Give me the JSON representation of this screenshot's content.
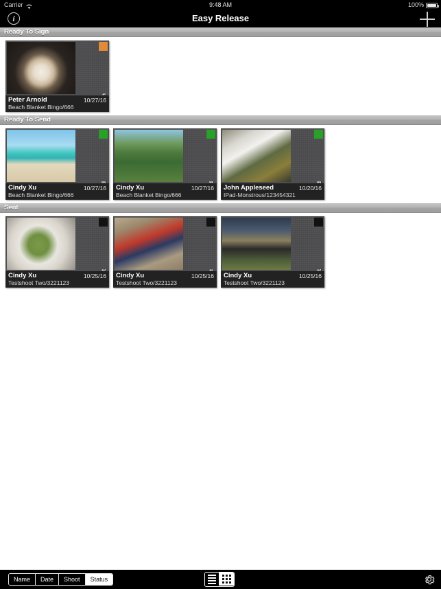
{
  "status_bar": {
    "carrier": "Carrier",
    "wifi_icon": "wifi-icon",
    "time": "9:48 AM",
    "battery_percent": "100%",
    "battery_icon": "battery-icon"
  },
  "nav_bar": {
    "title": "Easy Release",
    "info_icon": "info-icon",
    "info_label": "i",
    "add_icon": "plus-icon"
  },
  "sections": [
    {
      "title": "Ready To Sign",
      "status_color": "#e08a3c",
      "status_label": "Ready To Sign",
      "cards": [
        {
          "name": "Peter Arnold",
          "date": "10/27/16",
          "shoot": "Beach Blanket Bingo/666",
          "status_label": "Ready To Sign",
          "status_color": "#e08a3c",
          "thumb": "tuxedo-cat-portrait"
        }
      ]
    },
    {
      "title": "Ready To Send",
      "status_color": "#27a127",
      "status_label": "Ready To Send",
      "cards": [
        {
          "name": "Cindy Xu",
          "date": "10/27/16",
          "shoot": "Beach Blanket Bingo/666",
          "status_label": "Ready To Send",
          "status_color": "#27a127",
          "thumb": "beach-woman-red-sarong"
        },
        {
          "name": "Cindy Xu",
          "date": "10/27/16",
          "shoot": "Beach Blanket Bingo/666",
          "status_label": "Ready To Send",
          "status_color": "#27a127",
          "thumb": "tire-swing-woman"
        },
        {
          "name": "John Appleseed",
          "date": "10/20/16",
          "shoot": "IPad-Monstrous/123454321",
          "status_label": "Ready To Send",
          "status_color": "#27a127",
          "thumb": "waterfall-mossy-rocks"
        }
      ]
    },
    {
      "title": "Sent",
      "status_color": "#121212",
      "status_label": "Sent",
      "cards": [
        {
          "name": "Cindy Xu",
          "date": "10/25/16",
          "shoot": "Testshoot Two/3221123",
          "status_label": "Sent",
          "status_color": "#121212",
          "thumb": "green-face-mask-woman"
        },
        {
          "name": "Cindy Xu",
          "date": "10/25/16",
          "shoot": "Testshoot Two/3221123",
          "status_label": "Sent",
          "status_color": "#121212",
          "thumb": "woman-lying-red-shirt"
        },
        {
          "name": "Cindy Xu",
          "date": "10/25/16",
          "shoot": "Testshoot Two/3221123",
          "status_label": "Sent",
          "status_color": "#121212",
          "thumb": "woman-rainbow-field"
        }
      ]
    }
  ],
  "toolbar": {
    "sort_options": [
      {
        "label": "Name",
        "active": false
      },
      {
        "label": "Date",
        "active": false
      },
      {
        "label": "Shoot",
        "active": false
      },
      {
        "label": "Status",
        "active": true
      }
    ],
    "view_modes": [
      {
        "icon": "list-view-icon",
        "active": false
      },
      {
        "icon": "grid-view-icon",
        "active": true
      }
    ],
    "settings_icon": "gear-icon"
  }
}
